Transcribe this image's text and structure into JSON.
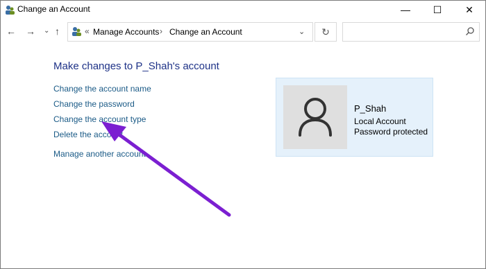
{
  "window": {
    "title": "Change an Account",
    "minimize_glyph": "—",
    "maximize_glyph": "☐",
    "close_glyph": "✕"
  },
  "nav": {
    "back_glyph": "←",
    "forward_glyph": "→",
    "recent_glyph": "⌄",
    "up_glyph": "↑",
    "crumb_overflow": "«",
    "crumbs": [
      "Manage Accounts",
      "Change an Account"
    ],
    "crumb_separator": "›",
    "address_dropdown_glyph": "⌄",
    "refresh_glyph": "↻",
    "search_placeholder": ""
  },
  "main": {
    "heading": "Make changes to P_Shah's account",
    "tasks": [
      "Change the account name",
      "Change the password",
      "Change the account type",
      "Delete the account",
      "Manage another account"
    ]
  },
  "account": {
    "name": "P_Shah",
    "type": "Local Account",
    "password_status": "Password protected"
  },
  "colors": {
    "link": "#1a5a86",
    "heading": "#1e3287",
    "card_bg": "#e5f1fb",
    "annotation_arrow": "#7b1fd1"
  },
  "icons": {
    "title": "users-control-panel-icon",
    "address": "users-control-panel-icon",
    "search": "search-icon",
    "avatar": "user-silhouette-icon"
  }
}
